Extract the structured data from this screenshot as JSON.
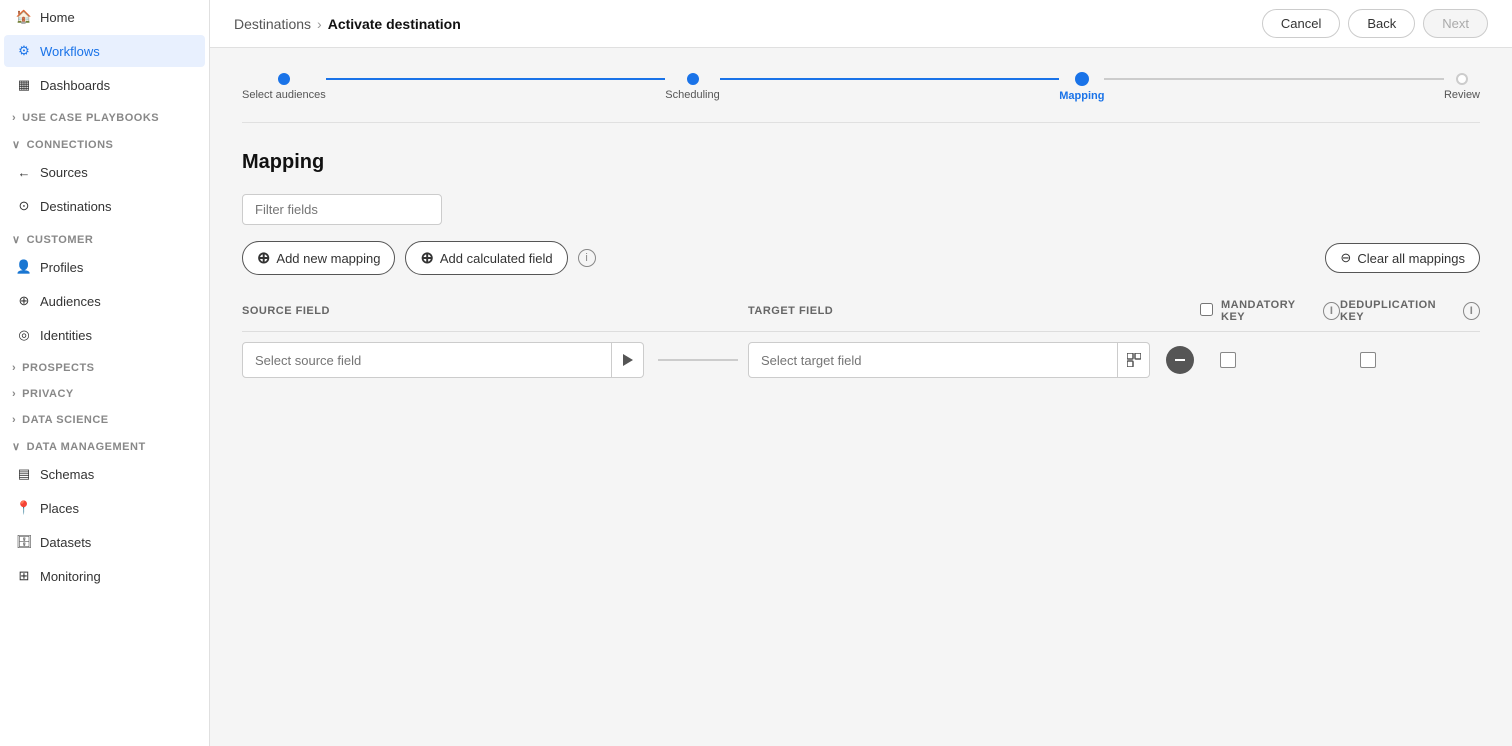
{
  "topbar": {
    "breadcrumb_parent": "Destinations",
    "breadcrumb_separator": "›",
    "breadcrumb_current": "Activate destination",
    "cancel_label": "Cancel",
    "back_label": "Back",
    "next_label": "Next"
  },
  "stepper": {
    "steps": [
      {
        "label": "Select audiences",
        "state": "completed"
      },
      {
        "label": "Scheduling",
        "state": "completed"
      },
      {
        "label": "Mapping",
        "state": "active"
      },
      {
        "label": "Review",
        "state": "inactive"
      }
    ]
  },
  "mapping": {
    "title": "Mapping",
    "filter_placeholder": "Filter fields",
    "add_mapping_label": "Add new mapping",
    "add_calculated_label": "Add calculated field",
    "clear_all_label": "Clear all mappings",
    "source_field_header": "SOURCE FIELD",
    "target_field_header": "TARGET FIELD",
    "mandatory_key_header": "MANDATORY KEY",
    "deduplication_key_header": "DEDUPLICATION KEY",
    "rows": [
      {
        "source_placeholder": "Select source field",
        "target_placeholder": "Select target field"
      }
    ]
  },
  "sidebar": {
    "home_label": "Home",
    "workflows_label": "Workflows",
    "dashboards_label": "Dashboards",
    "use_case_playbooks_label": "USE CASE PLAYBOOKS",
    "connections_label": "CONNECTIONS",
    "sources_label": "Sources",
    "destinations_label": "Destinations",
    "customer_label": "CUSTOMER",
    "profiles_label": "Profiles",
    "audiences_label": "Audiences",
    "identities_label": "Identities",
    "prospects_label": "PROSPECTS",
    "privacy_label": "PRIVACY",
    "data_science_label": "DATA SCIENCE",
    "data_management_label": "DATA MANAGEMENT",
    "schemas_label": "Schemas",
    "places_label": "Places",
    "datasets_label": "Datasets",
    "monitoring_label": "Monitoring"
  }
}
